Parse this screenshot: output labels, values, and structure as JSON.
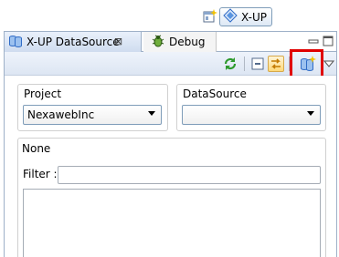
{
  "perspective": {
    "open_icon": "open-perspective-icon",
    "current": "X-UP",
    "current_icon": "xup-perspective-icon"
  },
  "tabs": [
    {
      "label": "X-UP DataSource",
      "icon": "datasource-icon",
      "active": true,
      "close_glyph": "⊠"
    },
    {
      "label": "Debug",
      "icon": "bug-icon",
      "active": false
    }
  ],
  "toolbar": {
    "buttons": [
      "refresh-icon",
      "collapse-icon",
      "link-with-editor-icon",
      "new-datasource-icon",
      "view-menu-icon"
    ],
    "highlight_color": "#e00000"
  },
  "project": {
    "label": "Project",
    "selected": "NexawebInc"
  },
  "datasource": {
    "label": "DataSource",
    "selected": ""
  },
  "details": {
    "label": "None",
    "filter_label": "Filter :",
    "filter_value": ""
  }
}
